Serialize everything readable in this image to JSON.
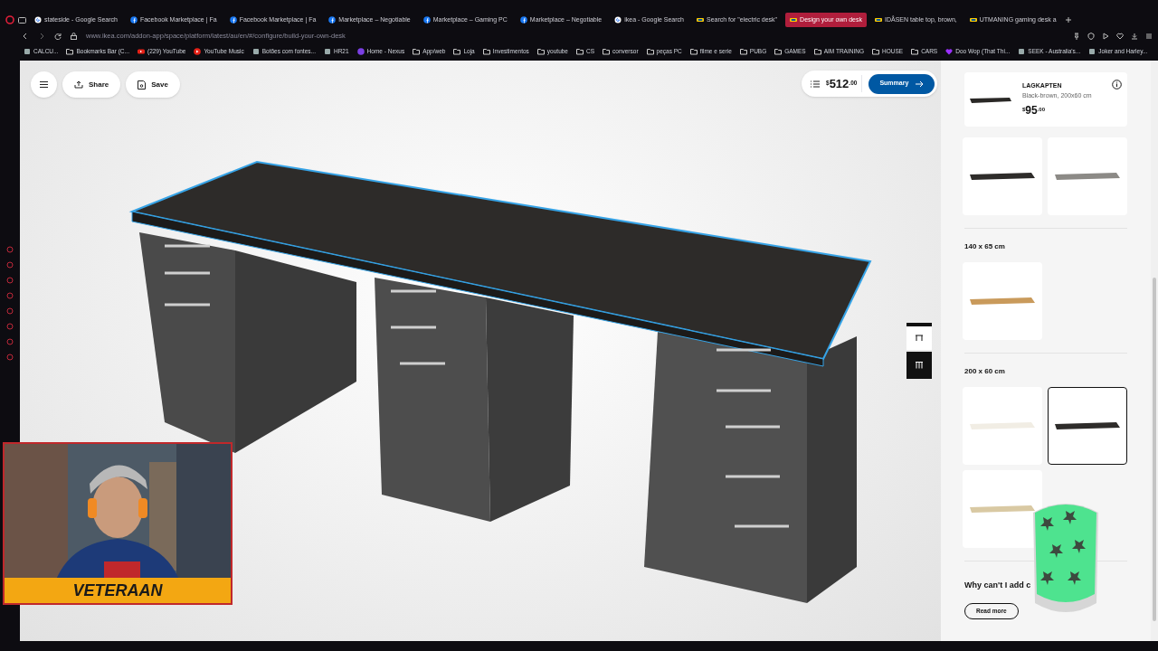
{
  "browser": {
    "tabs": [
      {
        "label": "stateside - Google Search",
        "selected": false,
        "kind": "google"
      },
      {
        "label": "Facebook Marketplace | Fa",
        "selected": false,
        "kind": "facebook"
      },
      {
        "label": "Facebook Marketplace | Fa",
        "selected": false,
        "kind": "facebook"
      },
      {
        "label": "Marketplace – Negotiable",
        "selected": false,
        "kind": "facebook"
      },
      {
        "label": "Marketplace – Gaming PC",
        "selected": false,
        "kind": "facebook"
      },
      {
        "label": "Marketplace – Negotiable",
        "selected": false,
        "kind": "facebook"
      },
      {
        "label": "ikea - Google Search",
        "selected": false,
        "kind": "google"
      },
      {
        "label": "Search for \"electric desk\"",
        "selected": false,
        "kind": "ikea"
      },
      {
        "label": "Design your own desk",
        "selected": true,
        "kind": "ikea"
      },
      {
        "label": "IDÅSEN table top, brown,",
        "selected": false,
        "kind": "ikea"
      },
      {
        "label": "UTMANING gaming desk a",
        "selected": false,
        "kind": "ikea"
      }
    ],
    "url": "www.ikea.com/addon-app/space/platform/latest/au/en/#/configure/build-your-own-desk",
    "bookmarks": [
      {
        "label": "CALCU...",
        "kind": "page"
      },
      {
        "label": "Bookmarks Bar (C...",
        "kind": "folder"
      },
      {
        "label": "(229) YouTube",
        "kind": "youtube"
      },
      {
        "label": "YouTube Music",
        "kind": "music"
      },
      {
        "label": "Botões com fontes...",
        "kind": "page"
      },
      {
        "label": "HR21",
        "kind": "page"
      },
      {
        "label": "Home - Nexus",
        "kind": "nexus"
      },
      {
        "label": "App/web",
        "kind": "folder"
      },
      {
        "label": "Loja",
        "kind": "folder"
      },
      {
        "label": "Investimentos",
        "kind": "folder"
      },
      {
        "label": "youtube",
        "kind": "folder"
      },
      {
        "label": "CS",
        "kind": "folder"
      },
      {
        "label": "conversor",
        "kind": "folder"
      },
      {
        "label": "peças PC",
        "kind": "folder"
      },
      {
        "label": "filme e serie",
        "kind": "folder"
      },
      {
        "label": "PUBG",
        "kind": "folder"
      },
      {
        "label": "GAMES",
        "kind": "folder"
      },
      {
        "label": "AIM TRAINING",
        "kind": "folder"
      },
      {
        "label": "HOUSE",
        "kind": "folder"
      },
      {
        "label": "CARS",
        "kind": "folder"
      },
      {
        "label": "Doo Wop (That Thi...",
        "kind": "heart"
      },
      {
        "label": "SEEK - Australia's...",
        "kind": "page"
      },
      {
        "label": "Joker and Harley...",
        "kind": "page"
      }
    ]
  },
  "toolbar": {
    "share": "Share",
    "save": "Save"
  },
  "price": {
    "currency": "$",
    "whole": "512",
    "cents": ".00"
  },
  "summary_button": "Summary",
  "view_tools": [
    {
      "kind": "desk",
      "selected": false
    },
    {
      "kind": "parts",
      "selected": true
    }
  ],
  "product": {
    "name": "LAGKAPTEN",
    "description": "Black-brown, 200x60 cm",
    "currency": "$",
    "whole": "95",
    "cents": ".00"
  },
  "sections": [
    {
      "options": [
        {
          "color": "#2e2c2a",
          "selected": false
        },
        {
          "color": "#8c8a86",
          "selected": false
        }
      ]
    },
    {
      "heading": "140 x 65 cm",
      "options": [
        {
          "color": "#c99a5b",
          "selected": false
        }
      ]
    },
    {
      "heading": "200 x 60 cm",
      "options": [
        {
          "color": "#f1ede4",
          "selected": false
        },
        {
          "color": "#2e2c2a",
          "selected": true
        },
        {
          "color": "#d9c9a3",
          "selected": false
        }
      ]
    }
  ],
  "question": "Why can't I add c",
  "read_more": "Read more",
  "overlay": {
    "banner": "VETERAAN"
  }
}
